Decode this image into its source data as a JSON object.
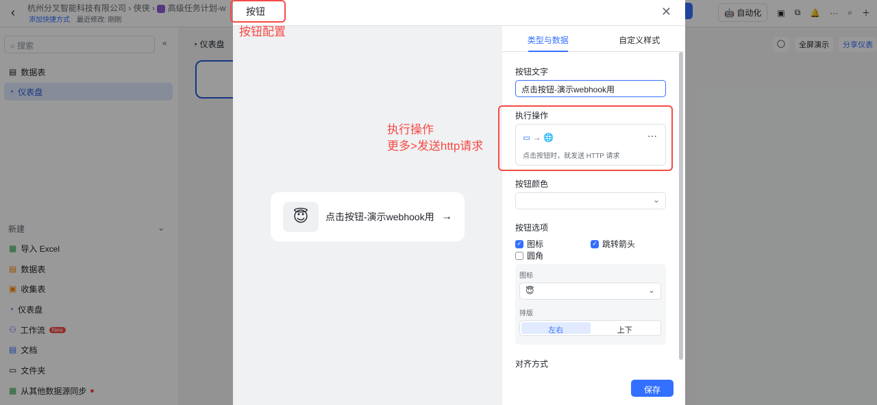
{
  "topbar": {
    "company": "杭州分叉智能科技有限公司",
    "space": "侠侠",
    "doc": "高级任务计划-w",
    "add_shortcut": "添加快捷方式",
    "last_modified": "最近修改: 刚刚",
    "automation": "自动化"
  },
  "sidebar": {
    "search_placeholder": "搜索",
    "items": [
      {
        "label": "数据表"
      },
      {
        "label": "仪表盘"
      }
    ],
    "new_header": "新建",
    "new_items": [
      {
        "label": "导入 Excel"
      },
      {
        "label": "数据表"
      },
      {
        "label": "收集表"
      },
      {
        "label": "仪表盘"
      },
      {
        "label": "工作流",
        "badge": "New"
      },
      {
        "label": "文档"
      },
      {
        "label": "文件夹"
      },
      {
        "label": "从其他数据源同步"
      }
    ]
  },
  "content": {
    "title": "仪表盘",
    "fullscreen": "全屏演示",
    "share": "分享仪表"
  },
  "modal": {
    "title": "按钮",
    "preview_label": "点击按钮-演示webhook用",
    "tabs": [
      "类型与数据",
      "自定义样式"
    ],
    "button_text_label": "按钮文字",
    "button_text_value": "点击按钮-演示webhook用",
    "action_label": "执行操作",
    "action_desc": "点击按钮时，就发送 HTTP 请求",
    "color_label": "按钮颜色",
    "options_label": "按钮选项",
    "options": [
      {
        "label": "图标",
        "checked": true
      },
      {
        "label": "跳转箭头",
        "checked": true
      },
      {
        "label": "圆角",
        "checked": false
      }
    ],
    "icon_label": "图标",
    "layout_label": "排版",
    "layout_options": [
      "左右",
      "上下"
    ],
    "align_label": "对齐方式",
    "save": "保存"
  },
  "annotations": {
    "a1": "按钮配置",
    "a2_line1": "执行操作",
    "a2_line2": "更多>发送http请求"
  }
}
